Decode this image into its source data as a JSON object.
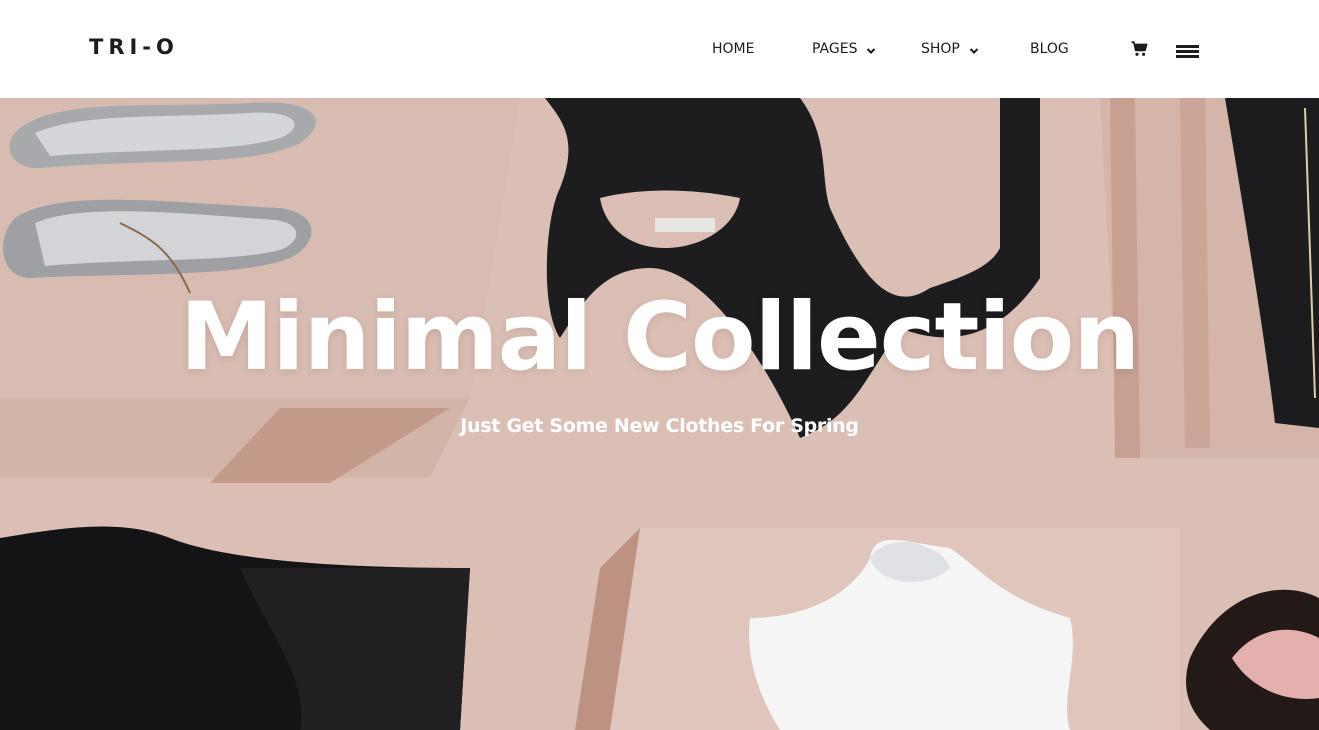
{
  "brand": {
    "logo_text": "TRI-O"
  },
  "nav": {
    "items": [
      {
        "label": "HOME",
        "has_dropdown": false
      },
      {
        "label": "PAGES",
        "has_dropdown": true
      },
      {
        "label": "SHOP",
        "has_dropdown": true
      },
      {
        "label": "BLOG",
        "has_dropdown": false
      }
    ],
    "cart_icon": "cart-icon",
    "menu_icon": "hamburger-menu-icon"
  },
  "hero": {
    "title": "Minimal Collection",
    "subtitle": "Just Get Some New Clothes For Spring",
    "background_color": "#dcbfb4"
  },
  "colors": {
    "header_bg": "#ffffff",
    "text_dark": "#1c1c1c",
    "hero_text": "#ffffff"
  }
}
